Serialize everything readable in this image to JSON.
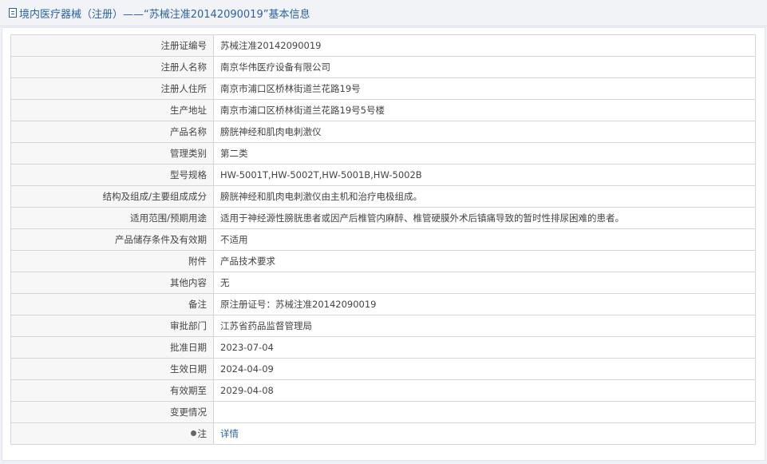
{
  "header": {
    "title": "境内医疗器械（注册）——“苏械注准20142090019”基本信息",
    "icon": "document-icon"
  },
  "rows": [
    {
      "label": "注册证编号",
      "value": "苏械注准20142090019"
    },
    {
      "label": "注册人名称",
      "value": "南京华伟医疗设备有限公司"
    },
    {
      "label": "注册人住所",
      "value": "南京市浦口区桥林街道兰花路19号"
    },
    {
      "label": "生产地址",
      "value": "南京市浦口区桥林街道兰花路19号5号楼"
    },
    {
      "label": "产品名称",
      "value": "膀胱神经和肌肉电刺激仪"
    },
    {
      "label": "管理类别",
      "value": "第二类"
    },
    {
      "label": "型号规格",
      "value": "HW-5001T,HW-5002T,HW-5001B,HW-5002B"
    },
    {
      "label": "结构及组成/主要组成成分",
      "value": "膀胱神经和肌肉电刺激仪由主机和治疗电极组成。"
    },
    {
      "label": "适用范围/预期用途",
      "value": "适用于神经源性膀胱患者或因产后椎管内麻醉、椎管硬膜外术后镇痛导致的暂时性排尿困难的患者。"
    },
    {
      "label": "产品储存条件及有效期",
      "value": "不适用"
    },
    {
      "label": "附件",
      "value": "产品技术要求"
    },
    {
      "label": "其他内容",
      "value": "无"
    },
    {
      "label": "备注",
      "value": "原注册证号：苏械注准20142090019"
    },
    {
      "label": "审批部门",
      "value": "江苏省药品监督管理局"
    },
    {
      "label": "批准日期",
      "value": "2023-07-04"
    },
    {
      "label": "生效日期",
      "value": "2024-04-09"
    },
    {
      "label": "有效期至",
      "value": "2029-04-08"
    },
    {
      "label": "变更情况",
      "value": ""
    }
  ],
  "note": {
    "label": "注",
    "link_text": "详情",
    "icon": "bullet-icon"
  }
}
